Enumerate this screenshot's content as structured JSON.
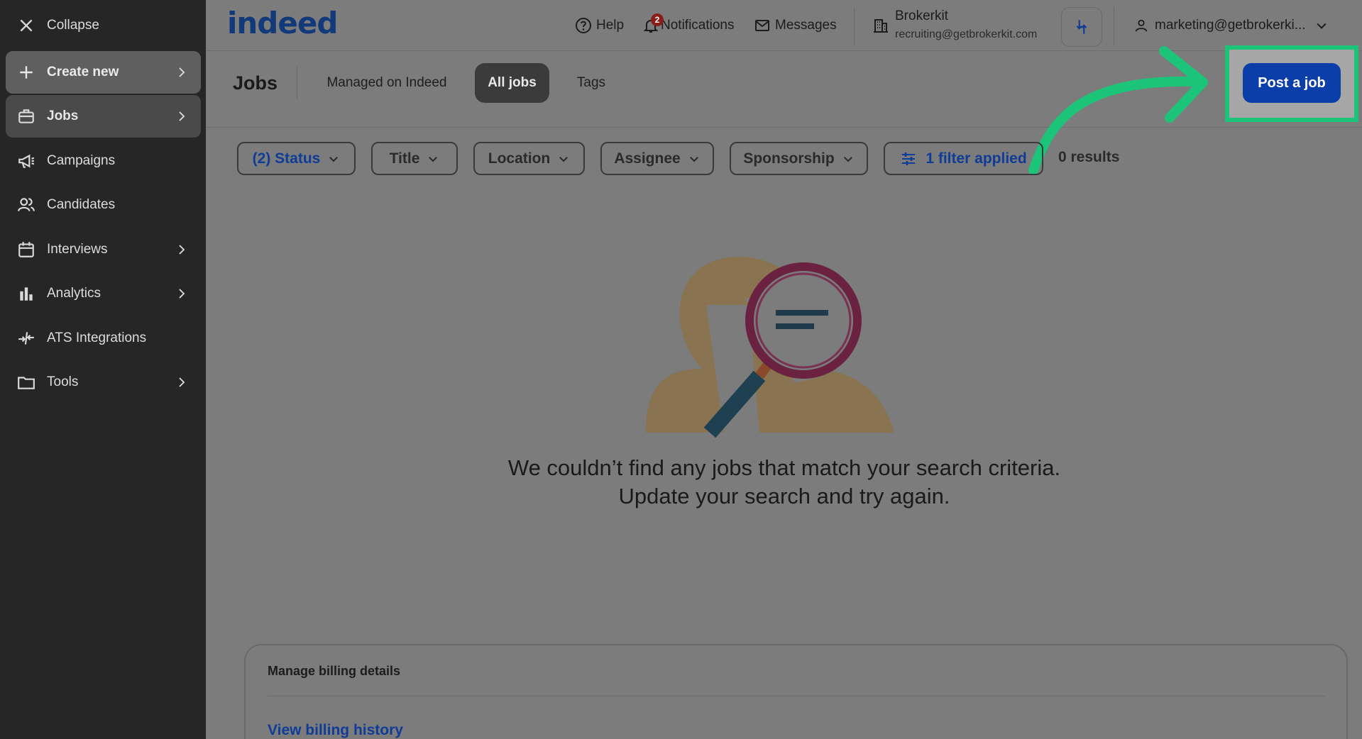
{
  "sidebar": {
    "collapse_label": "Collapse",
    "items": [
      {
        "label": "Create new",
        "icon": "plus-icon"
      },
      {
        "label": "Jobs",
        "icon": "briefcase-icon"
      },
      {
        "label": "Campaigns",
        "icon": "megaphone-icon"
      },
      {
        "label": "Candidates",
        "icon": "people-icon"
      },
      {
        "label": "Interviews",
        "icon": "calendar-icon"
      },
      {
        "label": "Analytics",
        "icon": "bar-chart-icon"
      },
      {
        "label": "ATS Integrations",
        "icon": "integration-icon"
      },
      {
        "label": "Tools",
        "icon": "folder-icon"
      }
    ]
  },
  "header": {
    "logo": "indeed",
    "help": "Help",
    "notifications": "Notifications",
    "notifications_count": "2",
    "messages": "Messages",
    "company_name": "Brokerkit",
    "company_email": "recruiting@getbrokerkit.com",
    "account": "marketing@getbrokerki..."
  },
  "jobs_nav": {
    "title": "Jobs",
    "tabs": [
      "Managed on Indeed",
      "All jobs",
      "Tags"
    ],
    "active_tab": "All jobs",
    "post_button": "Post a job"
  },
  "filters": {
    "status": "(2) Status",
    "title": "Title",
    "location": "Location",
    "assignee": "Assignee",
    "sponsorship": "Sponsorship",
    "applied": "1 filter applied",
    "results": "0 results"
  },
  "empty_state": {
    "line1": "We couldn’t find any jobs that match your search criteria.",
    "line2": "Update your search and try again."
  },
  "billing": {
    "title": "Manage billing details",
    "link": "View billing history"
  },
  "colors": {
    "brand_blue": "#0b3ea8",
    "highlight_green": "#1cc47a",
    "sidebar_bg": "#262626"
  }
}
